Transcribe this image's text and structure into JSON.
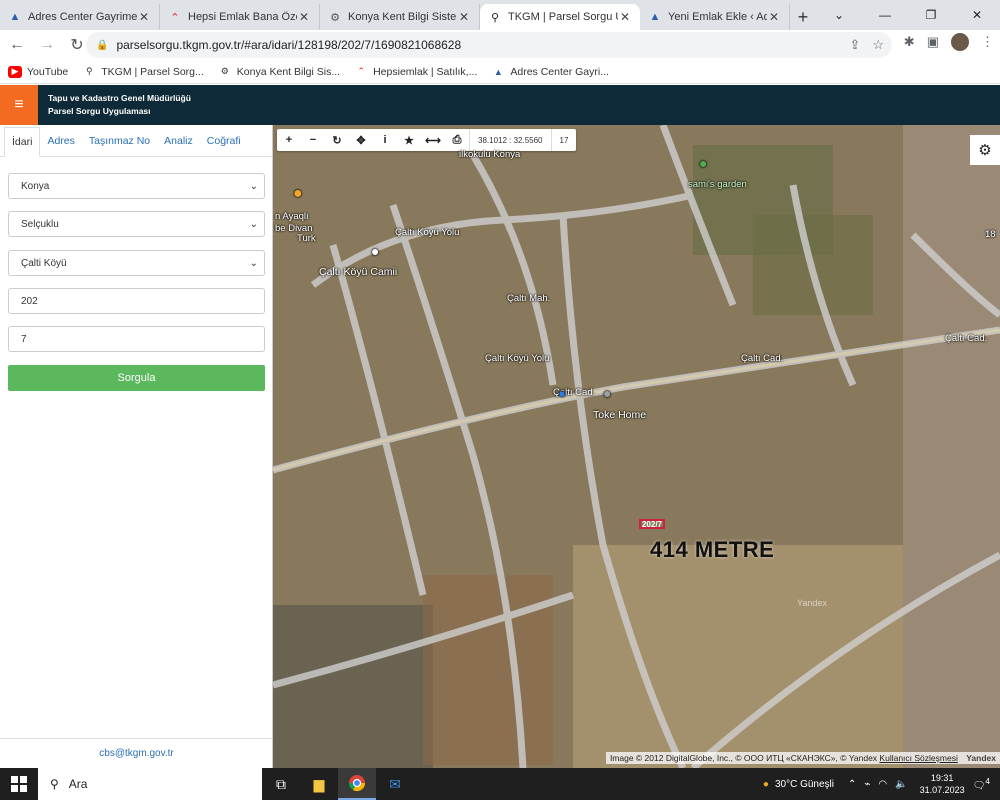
{
  "browser": {
    "tabs": [
      {
        "title": "Adres Center Gayrimenkul",
        "icon": "adres-center-favicon"
      },
      {
        "title": "Hepsi Emlak Bana Özel",
        "icon": "hepsiemlak-favicon"
      },
      {
        "title": "Konya Kent Bilgi Sistemi",
        "icon": "konya-favicon"
      },
      {
        "title": "TKGM | Parsel Sorgu Uyg",
        "icon": "location-pin-favicon",
        "active": true
      },
      {
        "title": "Yeni Emlak Ekle ‹ Adres Ce",
        "icon": "adres-center-favicon"
      }
    ],
    "url": "parselsorgu.tkgm.gov.tr/#ara/idari/128198/202/7/1690821068628",
    "bookmarks": [
      {
        "label": "YouTube"
      },
      {
        "label": "TKGM | Parsel Sorg..."
      },
      {
        "label": "Konya Kent Bilgi Sis..."
      },
      {
        "label": "Hepsiemlak | Satılık,..."
      },
      {
        "label": "Adres Center Gayri..."
      }
    ]
  },
  "app": {
    "title_line1": "Tapu ve Kadastro Genel Müdürlüğü",
    "title_line2": "Parsel Sorgu Uygulaması"
  },
  "sidebar": {
    "tabs": [
      "İdari",
      "Adres",
      "Taşınmaz No",
      "Analiz",
      "Coğrafi"
    ],
    "province": "Konya",
    "district": "Selçuklu",
    "neighborhood": "Çalti Köyü",
    "block": "202",
    "parcel": "7",
    "submit_label": "Sorgula",
    "footer_email": "cbs@tkgm.gov.tr"
  },
  "map": {
    "coordinates": "38.1012 : 32.5560",
    "zoom": "17",
    "labels": {
      "place1": "ilkokulu Konya",
      "place2": "sami's garden",
      "place3": "n Ayaqlı",
      "place4": "be Divan",
      "place5": "Turk",
      "road1": "Çaltı Köyü Yolu",
      "mosque": "Çaltı Köyü Camii",
      "street1": "Çaltı Mah.",
      "road2": "Çaltı Köyü Yolu",
      "street2": "Çaltı Cad.",
      "street3": "Çaltı Cad.",
      "street4": "Çaltı Cad.",
      "business": "Toke Home",
      "num": "18"
    },
    "parcel_label": "202/7",
    "distance_label": "414 METRE",
    "watermark": "Yandex",
    "attribution": "Image © 2012 DigitalGlobe, Inc., © ООО ИТЦ «СКАНЭКС», © Yandex",
    "terms": "Kullanıcı Sözleşmesi",
    "brand": "Yandex"
  },
  "taskbar": {
    "search_placeholder": "Ara",
    "weather": "30°C  Güneşli",
    "time": "19:31",
    "date": "31.07.2023",
    "notifications": "4"
  },
  "colors": {
    "header_bg": "#0e2a38",
    "menu_orange": "#f26b21",
    "submit_green": "#5cb85c",
    "link_blue": "#2a6fb3"
  }
}
